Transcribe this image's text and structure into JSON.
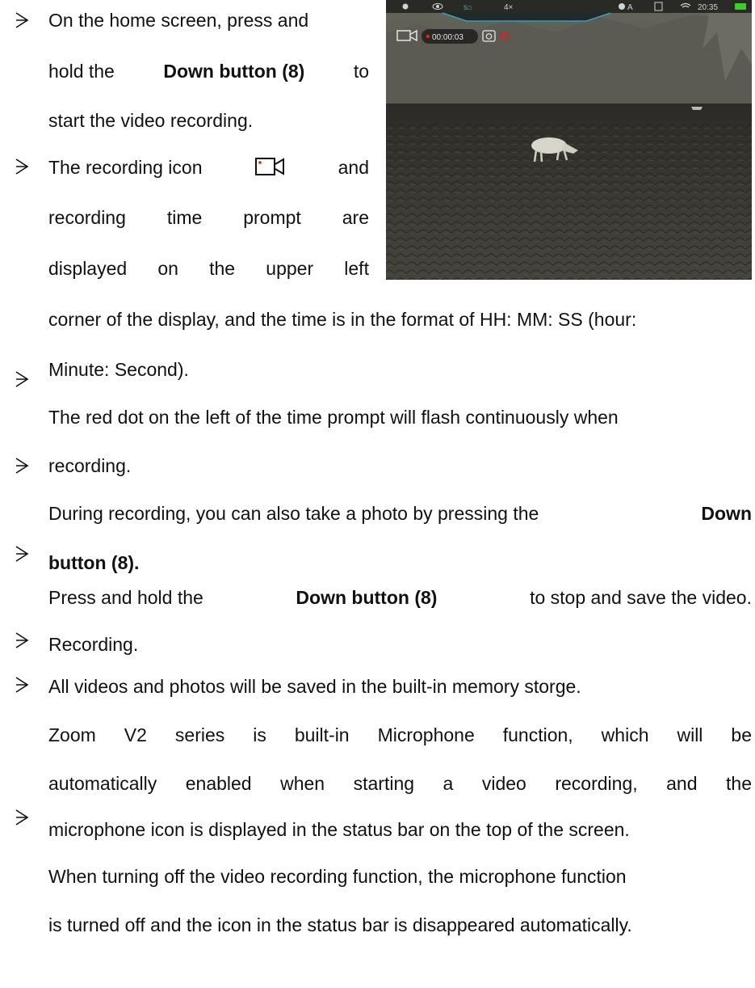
{
  "screen": {
    "status_bar": {
      "zoom": "4×",
      "mode": "A",
      "time": "20:35"
    },
    "rec_time": "00:00:03"
  },
  "text": {
    "b1": {
      "l1": "On the home screen, press and",
      "l2a": "hold the ",
      "l2b": "Down button (8)",
      "l2c": " to",
      "l3": "start the video recording."
    },
    "b2": {
      "l1a": "The recording icon",
      "l1b": "and",
      "l2": [
        "recording",
        "time",
        "prompt",
        "are"
      ],
      "l3": [
        "displayed",
        "on",
        "the",
        "upper",
        "left"
      ],
      "l4": "corner of the display, and the time is in the format of HH: MM: SS (hour:",
      "l5": "Minute: Second)."
    },
    "b3": {
      "l1": "The red dot on the left of the time prompt will flash continuously when",
      "l2": "recording."
    },
    "b4": {
      "l1a": "During recording, you can also take a photo by pressing the ",
      "l1b": "Down",
      "l2": "button (8)."
    },
    "b5": {
      "l1a": "Press and hold the ",
      "l1b": "Down button (8)",
      "l1c": " to stop and save the video.",
      "l2": "Recording."
    },
    "b6": {
      "l1": "All videos and photos will be saved in the built-in memory storge."
    },
    "b7": {
      "l1": "Zoom V2 series is built-in Microphone function, which will be",
      "l2": "automatically enabled when starting a video recording, and the",
      "l3": "microphone icon is displayed in the status bar on the top of the screen."
    },
    "b8": {
      "l1": "When turning off the video recording function, the microphone function",
      "l2": "is turned off and the icon in the status bar is disappeared automatically."
    }
  }
}
